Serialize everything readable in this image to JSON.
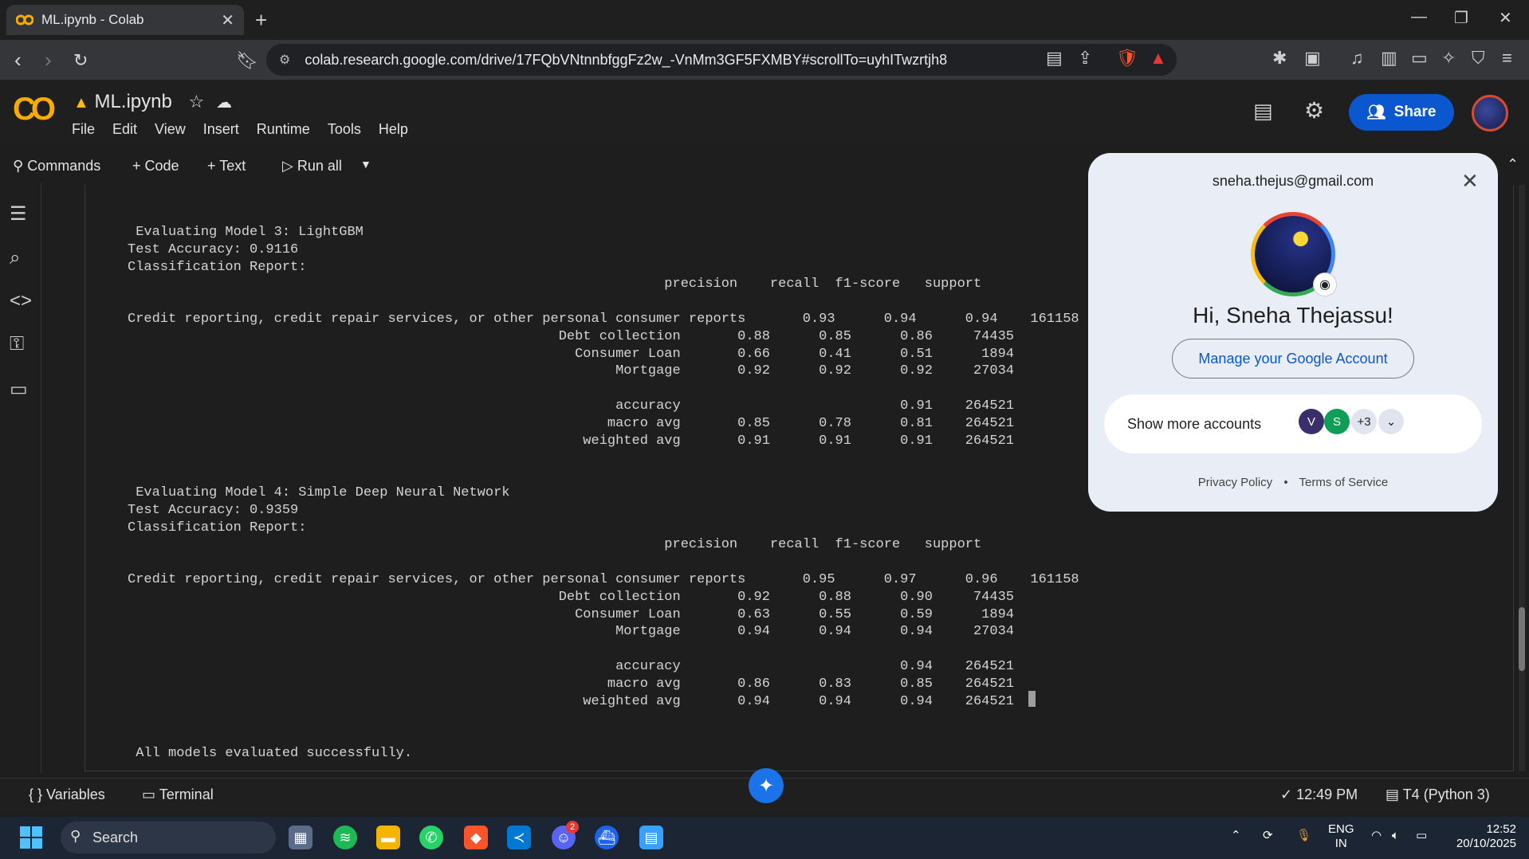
{
  "browser": {
    "tab_title": "ML.ipynb - Colab",
    "url": "colab.research.google.com/drive/17FQbVNtnnbfggFz2w_-VnMm3GF5FXMBY#scrollTo=uyhITwzrtjh8"
  },
  "colab": {
    "filename": "ML.ipynb",
    "menu": [
      "File",
      "Edit",
      "View",
      "Insert",
      "Runtime",
      "Tools",
      "Help"
    ],
    "share_label": "Share",
    "toolbar": {
      "commands": "Commands",
      "code": "+ Code",
      "text": "+ Text",
      "run_all": "Run all"
    }
  },
  "output_lines": [
    " Evaluating Model 3: LightGBM",
    "Test Accuracy: 0.9116",
    "Classification Report:",
    "                                                                  precision    recall  f1-score   support",
    "",
    "Credit reporting, credit repair services, or other personal consumer reports       0.93      0.94      0.94    161158",
    "                                                     Debt collection       0.88      0.85      0.86     74435",
    "                                                       Consumer Loan       0.66      0.41      0.51      1894",
    "                                                            Mortgage       0.92      0.92      0.92     27034",
    "",
    "                                                            accuracy                           0.91    264521",
    "                                                           macro avg       0.85      0.78      0.81    264521",
    "                                                        weighted avg       0.91      0.91      0.91    264521",
    "",
    "",
    " Evaluating Model 4: Simple Deep Neural Network",
    "Test Accuracy: 0.9359",
    "Classification Report:",
    "                                                                  precision    recall  f1-score   support",
    "",
    "Credit reporting, credit repair services, or other personal consumer reports       0.95      0.97      0.96    161158",
    "                                                     Debt collection       0.92      0.88      0.90     74435",
    "                                                       Consumer Loan       0.63      0.55      0.59      1894",
    "                                                            Mortgage       0.94      0.94      0.94     27034",
    "",
    "                                                            accuracy                           0.94    264521",
    "                                                           macro avg       0.86      0.83      0.85    264521",
    "                                                        weighted avg       0.94      0.94      0.94    264521",
    "",
    "",
    " All models evaluated successfully."
  ],
  "status": {
    "variables": "Variables",
    "terminal": "Terminal",
    "time": "12:49 PM",
    "runtime": "T4 (Python 3)"
  },
  "account_popup": {
    "email": "sneha.thejus@gmail.com",
    "greeting": "Hi, Sneha Thejassu!",
    "manage": "Manage your Google Account",
    "show_more": "Show more accounts",
    "chip_count": "+3",
    "chip_letter": "S",
    "privacy": "Privacy Policy",
    "terms": "Terms of Service"
  },
  "taskbar": {
    "search": "Search",
    "lang1": "ENG",
    "lang2": "IN",
    "clock_time": "12:52",
    "clock_date": "20/10/2025",
    "discord_badge": "2"
  }
}
